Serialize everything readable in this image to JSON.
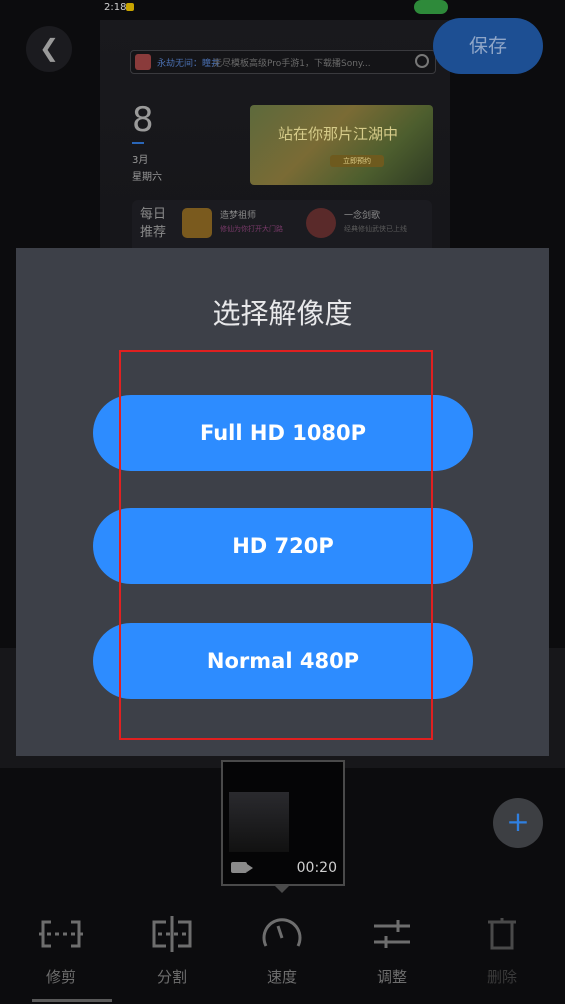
{
  "status_bar": {
    "time": "2:18"
  },
  "header": {
    "back_icon": "chevron-left-icon",
    "back_glyph": "❮",
    "save_label": "保存"
  },
  "preview": {
    "search": {
      "highlight": "永劫无间：瞳井",
      "text": "无尽模板高级Pro手游1，下载播Sony..."
    },
    "date": {
      "day": "8",
      "month": "3月",
      "weekday": "星期六"
    },
    "banner": {
      "title": "站在你那片江湖中",
      "button": "立即预约"
    },
    "recommend": {
      "label": "每日推荐",
      "items": [
        {
          "name": "造梦祖师",
          "desc": "修仙为你打开大门路"
        },
        {
          "name": "一念剑歌",
          "desc": "经典修仙武侠已上线"
        }
      ]
    }
  },
  "dialog": {
    "title": "选择解像度",
    "options": [
      "Full HD 1080P",
      "HD 720P",
      "Normal 480P"
    ]
  },
  "timeline": {
    "clip_duration": "00:20",
    "add_label": "+"
  },
  "toolbar": {
    "items": [
      {
        "label": "修剪",
        "icon": "trim-icon"
      },
      {
        "label": "分割",
        "icon": "split-icon"
      },
      {
        "label": "速度",
        "icon": "speedometer-icon"
      },
      {
        "label": "调整",
        "icon": "sliders-icon"
      },
      {
        "label": "删除",
        "icon": "trash-icon"
      }
    ]
  },
  "colors": {
    "accent": "#2d8cff",
    "dialog_bg": "#3d4048",
    "highlight": "#e02020"
  }
}
